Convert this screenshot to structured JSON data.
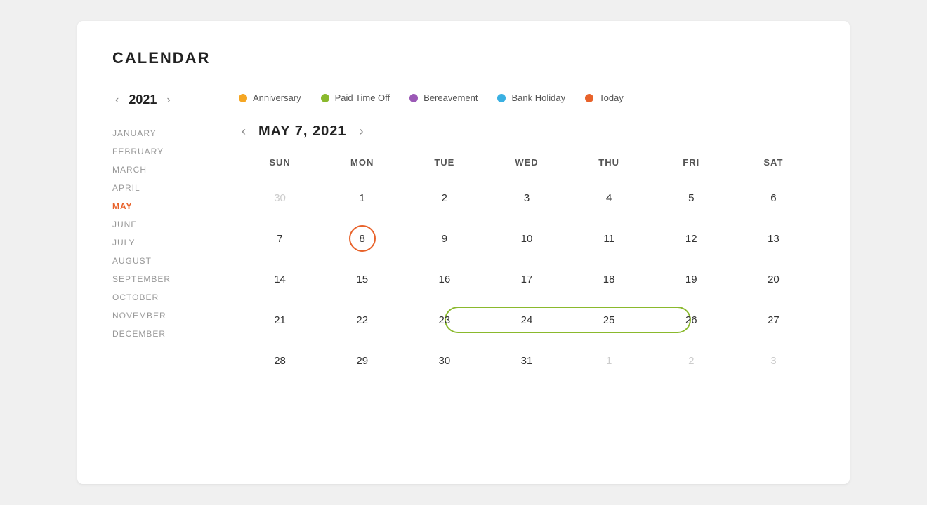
{
  "page": {
    "title": "CALENDAR"
  },
  "year": {
    "label": "2021",
    "prev_label": "‹",
    "next_label": "›"
  },
  "months": [
    {
      "label": "JANUARY",
      "active": false
    },
    {
      "label": "FEBRUARY",
      "active": false
    },
    {
      "label": "MARCH",
      "active": false
    },
    {
      "label": "APRIL",
      "active": false
    },
    {
      "label": "MAY",
      "active": true
    },
    {
      "label": "JUNE",
      "active": false
    },
    {
      "label": "JULY",
      "active": false
    },
    {
      "label": "AUGUST",
      "active": false
    },
    {
      "label": "SEPTEMBER",
      "active": false
    },
    {
      "label": "OCTOBER",
      "active": false
    },
    {
      "label": "NOVEMBER",
      "active": false
    },
    {
      "label": "DECEMBER",
      "active": false
    }
  ],
  "legend": [
    {
      "label": "Anniversary",
      "color": "#f5a623"
    },
    {
      "label": "Paid Time Off",
      "color": "#8ab92d"
    },
    {
      "label": "Bereavement",
      "color": "#9b59b6"
    },
    {
      "label": "Bank Holiday",
      "color": "#3ab0e2"
    },
    {
      "label": "Today",
      "color": "#e8622a"
    }
  ],
  "month_view": {
    "title": "MAY 7, 2021",
    "prev_label": "‹",
    "next_label": "›"
  },
  "weekdays": [
    "SUN",
    "MON",
    "TUE",
    "WED",
    "THU",
    "FRI",
    "SAT"
  ],
  "weeks": [
    [
      {
        "day": "30",
        "other": true
      },
      {
        "day": "1",
        "other": false
      },
      {
        "day": "2",
        "other": false
      },
      {
        "day": "3",
        "other": false
      },
      {
        "day": "4",
        "other": false
      },
      {
        "day": "5",
        "other": false
      },
      {
        "day": "6",
        "other": false
      }
    ],
    [
      {
        "day": "7",
        "other": false
      },
      {
        "day": "8",
        "other": false,
        "today": true
      },
      {
        "day": "9",
        "other": false
      },
      {
        "day": "10",
        "other": false
      },
      {
        "day": "11",
        "other": false
      },
      {
        "day": "12",
        "other": false
      },
      {
        "day": "13",
        "other": false
      }
    ],
    [
      {
        "day": "14",
        "other": false
      },
      {
        "day": "15",
        "other": false
      },
      {
        "day": "16",
        "other": false
      },
      {
        "day": "17",
        "other": false
      },
      {
        "day": "18",
        "other": false
      },
      {
        "day": "19",
        "other": false
      },
      {
        "day": "20",
        "other": false
      }
    ],
    [
      {
        "day": "21",
        "other": false
      },
      {
        "day": "22",
        "other": false
      },
      {
        "day": "23",
        "other": false,
        "pto_start": true
      },
      {
        "day": "24",
        "other": false,
        "pto_mid": true
      },
      {
        "day": "25",
        "other": false,
        "pto_mid": true
      },
      {
        "day": "26",
        "other": false,
        "pto_end": true
      },
      {
        "day": "27",
        "other": false
      }
    ],
    [
      {
        "day": "28",
        "other": false
      },
      {
        "day": "29",
        "other": false
      },
      {
        "day": "30",
        "other": false
      },
      {
        "day": "31",
        "other": false
      },
      {
        "day": "1",
        "other": true
      },
      {
        "day": "2",
        "other": true
      },
      {
        "day": "3",
        "other": true
      }
    ]
  ]
}
